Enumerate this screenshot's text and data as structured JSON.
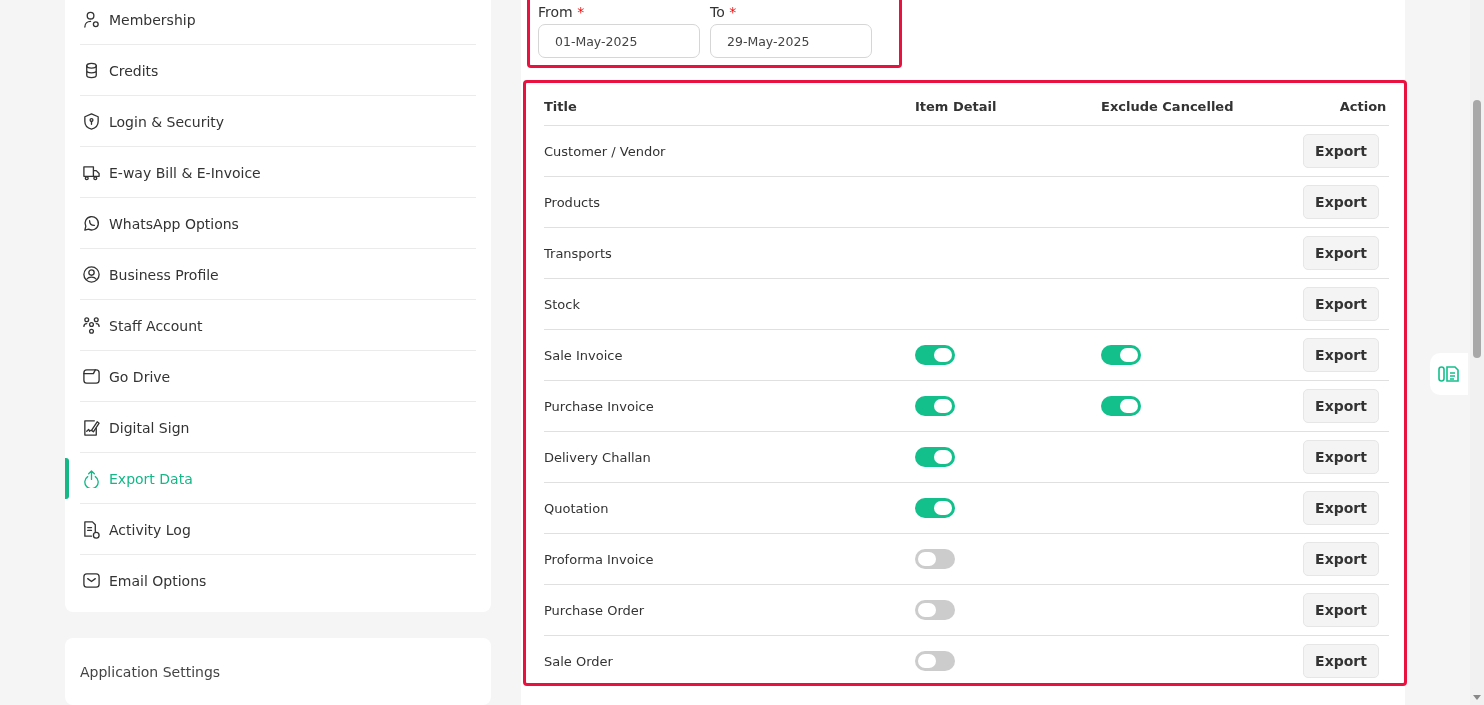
{
  "sidebar": {
    "items": [
      {
        "label": "Membership",
        "selected": false
      },
      {
        "label": "Credits",
        "selected": false
      },
      {
        "label": "Login & Security",
        "selected": false
      },
      {
        "label": "E-way Bill & E-Invoice",
        "selected": false
      },
      {
        "label": "WhatsApp Options",
        "selected": false
      },
      {
        "label": "Business Profile",
        "selected": false
      },
      {
        "label": "Staff Account",
        "selected": false
      },
      {
        "label": "Go Drive",
        "selected": false
      },
      {
        "label": "Digital Sign",
        "selected": false
      },
      {
        "label": "Export Data",
        "selected": true
      },
      {
        "label": "Activity Log",
        "selected": false
      },
      {
        "label": "Email Options",
        "selected": false
      }
    ]
  },
  "application_settings": {
    "title": "Application Settings"
  },
  "date_range": {
    "from": {
      "label": "From",
      "required_mark": "*",
      "value": "01-May-2025"
    },
    "to": {
      "label": "To",
      "required_mark": "*",
      "value": "29-May-2025"
    }
  },
  "table": {
    "columns": [
      "Title",
      "Item Detail",
      "Exclude Cancelled",
      "Action"
    ],
    "rows": [
      {
        "title": "Customer / Vendor",
        "action": "Export"
      },
      {
        "title": "Products",
        "action": "Export"
      },
      {
        "title": "Transports",
        "action": "Export"
      },
      {
        "title": "Stock",
        "action": "Export"
      },
      {
        "title": "Sale Invoice",
        "item_detail": true,
        "exclude_cancelled": true,
        "action": "Export"
      },
      {
        "title": "Purchase Invoice",
        "item_detail": true,
        "exclude_cancelled": true,
        "action": "Export"
      },
      {
        "title": "Delivery Challan",
        "item_detail": true,
        "action": "Export"
      },
      {
        "title": "Quotation",
        "item_detail": true,
        "action": "Export"
      },
      {
        "title": "Proforma Invoice",
        "item_detail": false,
        "action": "Export"
      },
      {
        "title": "Purchase Order",
        "item_detail": false,
        "action": "Export"
      },
      {
        "title": "Sale Order",
        "item_detail": false,
        "action": "Export"
      }
    ]
  }
}
